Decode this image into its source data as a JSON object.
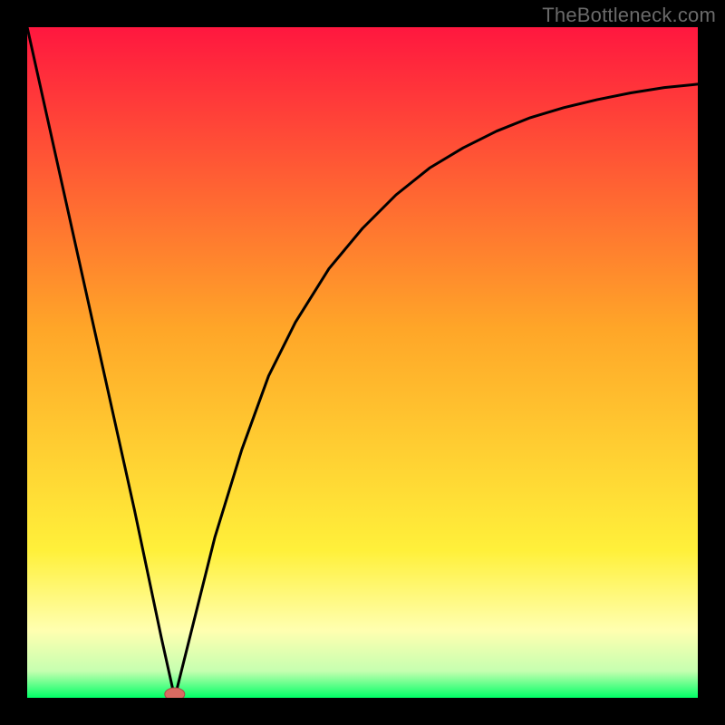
{
  "watermark": "TheBottleneck.com",
  "colors": {
    "red_top": "#ff173f",
    "orange_mid": "#ffa628",
    "yellow_low": "#fff03a",
    "pale_yellow": "#ffffb0",
    "pale_green": "#c6ffb0",
    "green_bottom": "#00ff66",
    "curve": "#000000",
    "marker_fill": "#d96a62",
    "marker_stroke": "#a84c46",
    "frame": "#000000"
  },
  "chart_data": {
    "type": "line",
    "title": "",
    "xlabel": "",
    "ylabel": "",
    "xlim": [
      0,
      100
    ],
    "ylim": [
      0,
      100
    ],
    "curve": {
      "min_x": 22,
      "points": [
        {
          "x": 0,
          "y": 100
        },
        {
          "x": 4,
          "y": 82
        },
        {
          "x": 8,
          "y": 64
        },
        {
          "x": 12,
          "y": 46
        },
        {
          "x": 16,
          "y": 28
        },
        {
          "x": 20,
          "y": 9
        },
        {
          "x": 22,
          "y": 0
        },
        {
          "x": 24,
          "y": 8
        },
        {
          "x": 28,
          "y": 24
        },
        {
          "x": 32,
          "y": 37
        },
        {
          "x": 36,
          "y": 48
        },
        {
          "x": 40,
          "y": 56
        },
        {
          "x": 45,
          "y": 64
        },
        {
          "x": 50,
          "y": 70
        },
        {
          "x": 55,
          "y": 75
        },
        {
          "x": 60,
          "y": 79
        },
        {
          "x": 65,
          "y": 82
        },
        {
          "x": 70,
          "y": 84.5
        },
        {
          "x": 75,
          "y": 86.5
        },
        {
          "x": 80,
          "y": 88
        },
        {
          "x": 85,
          "y": 89.2
        },
        {
          "x": 90,
          "y": 90.2
        },
        {
          "x": 95,
          "y": 91
        },
        {
          "x": 100,
          "y": 91.5
        }
      ]
    },
    "marker": {
      "x": 22,
      "y": 0
    }
  }
}
